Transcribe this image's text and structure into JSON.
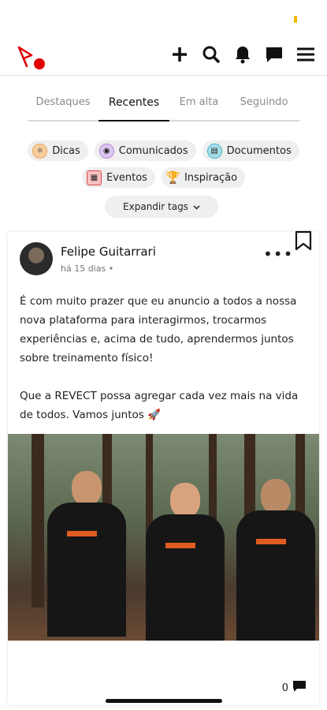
{
  "header": {
    "battery_color": "#f5b800",
    "accent": "#e00000"
  },
  "top_icons": [
    "plus-icon",
    "search-icon",
    "bell-icon",
    "chat-icon",
    "menu-icon"
  ],
  "tabs": [
    {
      "label": "Destaques"
    },
    {
      "label": "Recentes"
    },
    {
      "label": "Em alta"
    },
    {
      "label": "Seguindo"
    }
  ],
  "tags_row1": [
    {
      "label": "Dicas",
      "color": "#f0a35a"
    },
    {
      "label": "Comunicados",
      "color": "#b38ad8"
    },
    {
      "label": "Documentos",
      "color": "#3fb3c8"
    }
  ],
  "tags_row2": [
    {
      "label": "Eventos",
      "color": "#e0474c"
    },
    {
      "label": "Inspiração",
      "color": "#f2b705"
    }
  ],
  "expand_label": "Expandir tags",
  "post": {
    "author": "Felipe Guitarrari",
    "time": "há 15 dias •",
    "p1": "É com muito prazer que eu anuncio a todos a nossa nova plataforma para interagirmos, trocarmos experiências e, acima de tudo, aprendermos juntos sobre treinamento físico!",
    "p2": "Que a REVECT possa agregar cada vez mais na vida de todos. Vamos juntos 🚀",
    "comments": "0"
  }
}
